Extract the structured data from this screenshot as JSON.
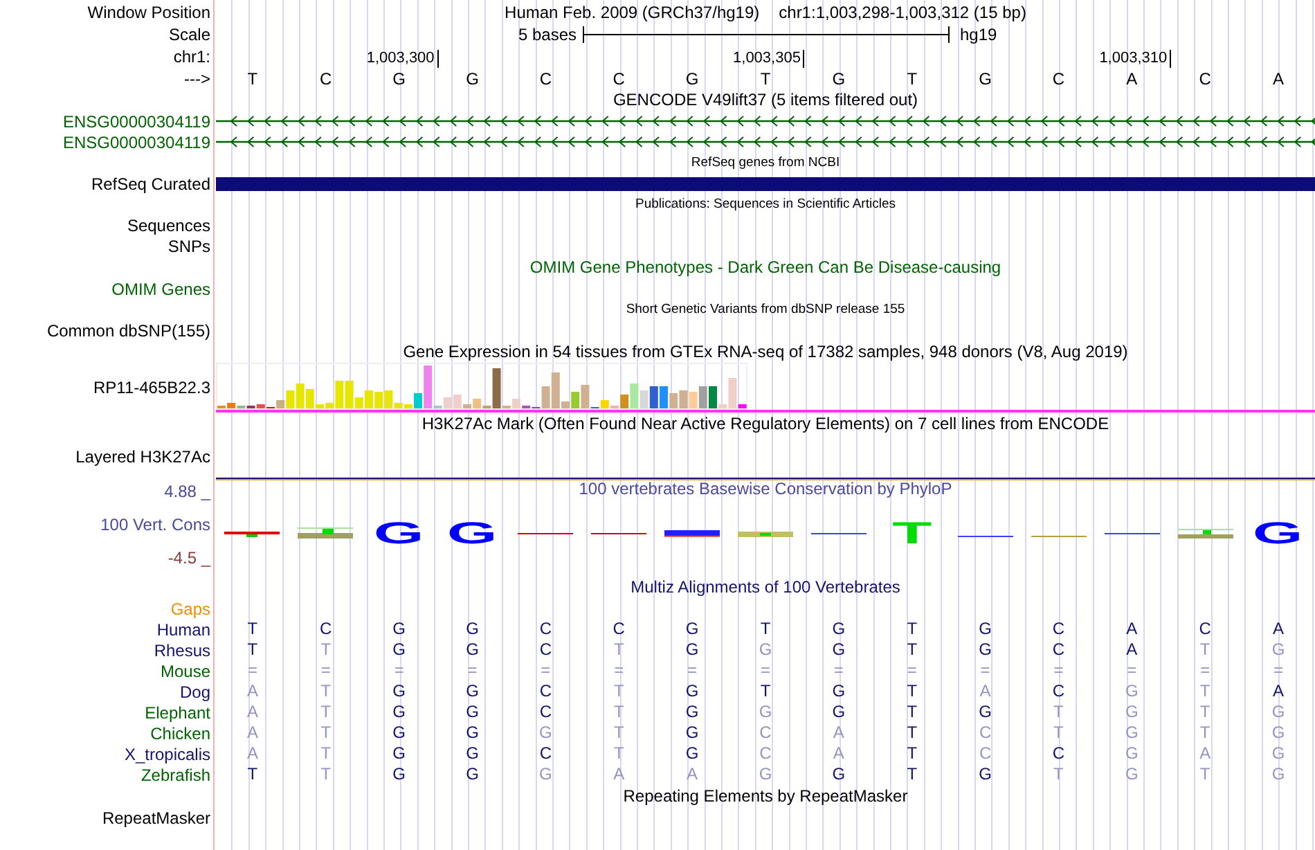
{
  "header": {
    "window_label": "Window Position",
    "assembly": "Human Feb. 2009 (GRCh37/hg19)",
    "position": "chr1:1,003,298-1,003,312 (15 bp)",
    "scale_label": "Scale",
    "scale_text": "5 bases",
    "scale_assembly": "hg19",
    "chrom_label": "chr1:",
    "strand_label": "--->"
  },
  "bases": [
    {
      "base": "T"
    },
    {
      "base": "C"
    },
    {
      "base": "G",
      "tick": "1,003,300",
      "logo": {
        "letter": "G",
        "color": "#0000ff"
      }
    },
    {
      "base": "G",
      "logo": {
        "letter": "G",
        "color": "#0000ff"
      }
    },
    {
      "base": "C"
    },
    {
      "base": "C"
    },
    {
      "base": "G"
    },
    {
      "base": "T",
      "tick": "1,003,305"
    },
    {
      "base": "G"
    },
    {
      "base": "T",
      "logo": {
        "letter": "T",
        "color": "#00dd00"
      }
    },
    {
      "base": "G"
    },
    {
      "base": "C"
    },
    {
      "base": "A",
      "tick": "1,003,310"
    },
    {
      "base": "C"
    },
    {
      "base": "A",
      "logo": {
        "letter": "G",
        "color": "#0000ff"
      }
    }
  ],
  "tracks": [
    {
      "kind": "title",
      "text": "GENCODE V49lift37 (5 items filtered out)"
    },
    {
      "kind": "gene",
      "label": "ENSG00000304119",
      "color": "#006400"
    },
    {
      "kind": "gene",
      "label": "ENSG00000304119",
      "color": "#006400"
    },
    {
      "kind": "note",
      "text": "RefSeq genes from NCBI"
    },
    {
      "kind": "bar",
      "label": "RefSeq Curated",
      "color": "#0c0c78"
    },
    {
      "kind": "note",
      "text": "Publications: Sequences in Scientific Articles"
    },
    {
      "kind": "label",
      "label": "Sequences"
    },
    {
      "kind": "label",
      "label": "SNPs"
    },
    {
      "kind": "title",
      "text": "OMIM Gene Phenotypes - Dark Green Can Be Disease-causing",
      "color": "#006400"
    },
    {
      "kind": "label",
      "label": "OMIM Genes",
      "color": "#006400"
    },
    {
      "kind": "note",
      "text": "Short Genetic Variants from dbSNP release 155"
    },
    {
      "kind": "label",
      "label": "Common dbSNP(155)"
    },
    {
      "kind": "title",
      "text": "Gene Expression in 54 tissues from GTEx RNA-seq of 17382 samples, 948 donors (V8, Aug 2019)"
    },
    {
      "kind": "expression",
      "label": "RP11-465B22.3"
    },
    {
      "kind": "title",
      "text": "H3K27Ac Mark (Often Found Near Active Regulatory Elements) on 7 cell lines from ENCODE"
    },
    {
      "kind": "layered",
      "label": "Layered H3K27Ac"
    },
    {
      "kind": "conservation",
      "label": "100 Vert. Cons",
      "max": "4.88 _",
      "min": "-4.5 _",
      "title": "100 vertebrates Basewise Conservation by PhyloP"
    },
    {
      "kind": "title",
      "text": "Multiz Alignments of 100 Vertebrates",
      "color": "#14146e"
    },
    {
      "kind": "label",
      "label": "Gaps",
      "color": "#f08c00"
    },
    {
      "kind": "species",
      "label": "Human",
      "color": "#14146e",
      "bases": [
        "T",
        "C",
        "G",
        "G",
        "C",
        "C",
        "G",
        "T",
        "G",
        "T",
        "G",
        "C",
        "A",
        "C",
        "A"
      ]
    },
    {
      "kind": "species",
      "label": "Rhesus",
      "color": "#14146e",
      "bases": [
        "T",
        "T",
        "G",
        "G",
        "C",
        "T",
        "G",
        "G",
        "G",
        "T",
        "G",
        "C",
        "A",
        "T",
        "G"
      ]
    },
    {
      "kind": "species",
      "label": "Mouse",
      "color": "#006400",
      "bases": [
        "=",
        "=",
        "=",
        "=",
        "=",
        "=",
        "=",
        "=",
        "=",
        "=",
        "=",
        "=",
        "=",
        "=",
        "="
      ]
    },
    {
      "kind": "species",
      "label": "Dog",
      "color": "#14146e",
      "bases": [
        "A",
        "T",
        "G",
        "G",
        "C",
        "T",
        "G",
        "T",
        "G",
        "T",
        "A",
        "C",
        "G",
        "T",
        "A"
      ]
    },
    {
      "kind": "species",
      "label": "Elephant",
      "color": "#006400",
      "bases": [
        "A",
        "T",
        "G",
        "G",
        "C",
        "T",
        "G",
        "G",
        "G",
        "T",
        "G",
        "T",
        "G",
        "T",
        "G"
      ]
    },
    {
      "kind": "species",
      "label": "Chicken",
      "color": "#006400",
      "bases": [
        "A",
        "T",
        "G",
        "G",
        "G",
        "T",
        "G",
        "C",
        "A",
        "T",
        "C",
        "T",
        "G",
        "T",
        "G"
      ]
    },
    {
      "kind": "species",
      "label": "X_tropicalis",
      "color": "#14146e",
      "bases": [
        "A",
        "T",
        "G",
        "G",
        "C",
        "T",
        "G",
        "C",
        "A",
        "T",
        "C",
        "C",
        "G",
        "A",
        "G"
      ]
    },
    {
      "kind": "species",
      "label": "Zebrafish",
      "color": "#006400",
      "bases": [
        "T",
        "T",
        "G",
        "G",
        "G",
        "A",
        "A",
        "G",
        "G",
        "T",
        "G",
        "T",
        "G",
        "T",
        "G"
      ]
    },
    {
      "kind": "title",
      "text": "Repeating Elements by RepeatMasker"
    },
    {
      "kind": "label",
      "label": "RepeatMasker"
    }
  ]
}
